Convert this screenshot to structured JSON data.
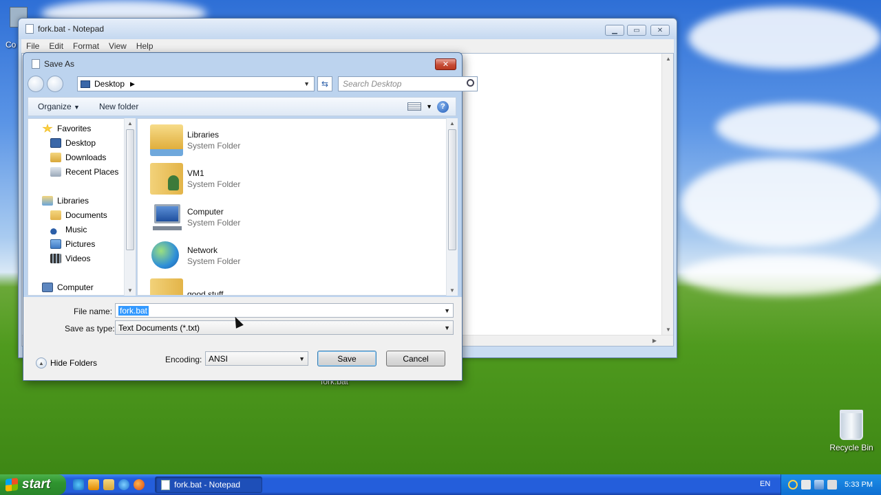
{
  "notepad": {
    "title": "fork.bat - Notepad",
    "menu": [
      "File",
      "Edit",
      "Format",
      "View",
      "Help"
    ]
  },
  "dialog": {
    "title": "Save As",
    "address": "Desktop",
    "search_placeholder": "Search Desktop",
    "toolbar": {
      "organize": "Organize",
      "new_folder": "New folder"
    },
    "nav": {
      "favorites": "Favorites",
      "favorites_items": [
        "Desktop",
        "Downloads",
        "Recent Places"
      ],
      "libraries": "Libraries",
      "libraries_items": [
        "Documents",
        "Music",
        "Pictures",
        "Videos"
      ],
      "computer": "Computer"
    },
    "files": [
      {
        "name": "Libraries",
        "type": "System Folder",
        "icon": "libraries-folder-icon"
      },
      {
        "name": "VM1",
        "type": "System Folder",
        "icon": "user-folder-icon"
      },
      {
        "name": "Computer",
        "type": "System Folder",
        "icon": "computer-icon"
      },
      {
        "name": "Network",
        "type": "System Folder",
        "icon": "network-icon"
      },
      {
        "name": "good stuff",
        "type": "",
        "icon": "folder-icon"
      }
    ],
    "file_name_label": "File name:",
    "file_name_value": "fork.bat",
    "save_type_label": "Save as type:",
    "save_type_value": "Text Documents (*.txt)",
    "hide_folders": "Hide Folders",
    "encoding_label": "Encoding:",
    "encoding_value": "ANSI",
    "save": "Save",
    "cancel": "Cancel"
  },
  "desktop": {
    "recycle_bin": "Recycle Bin",
    "fork_file": "fork.bat",
    "partial_label": "Co"
  },
  "taskbar": {
    "start": "start",
    "task": "fork.bat - Notepad",
    "lang": "EN",
    "clock": "5:33 PM"
  }
}
